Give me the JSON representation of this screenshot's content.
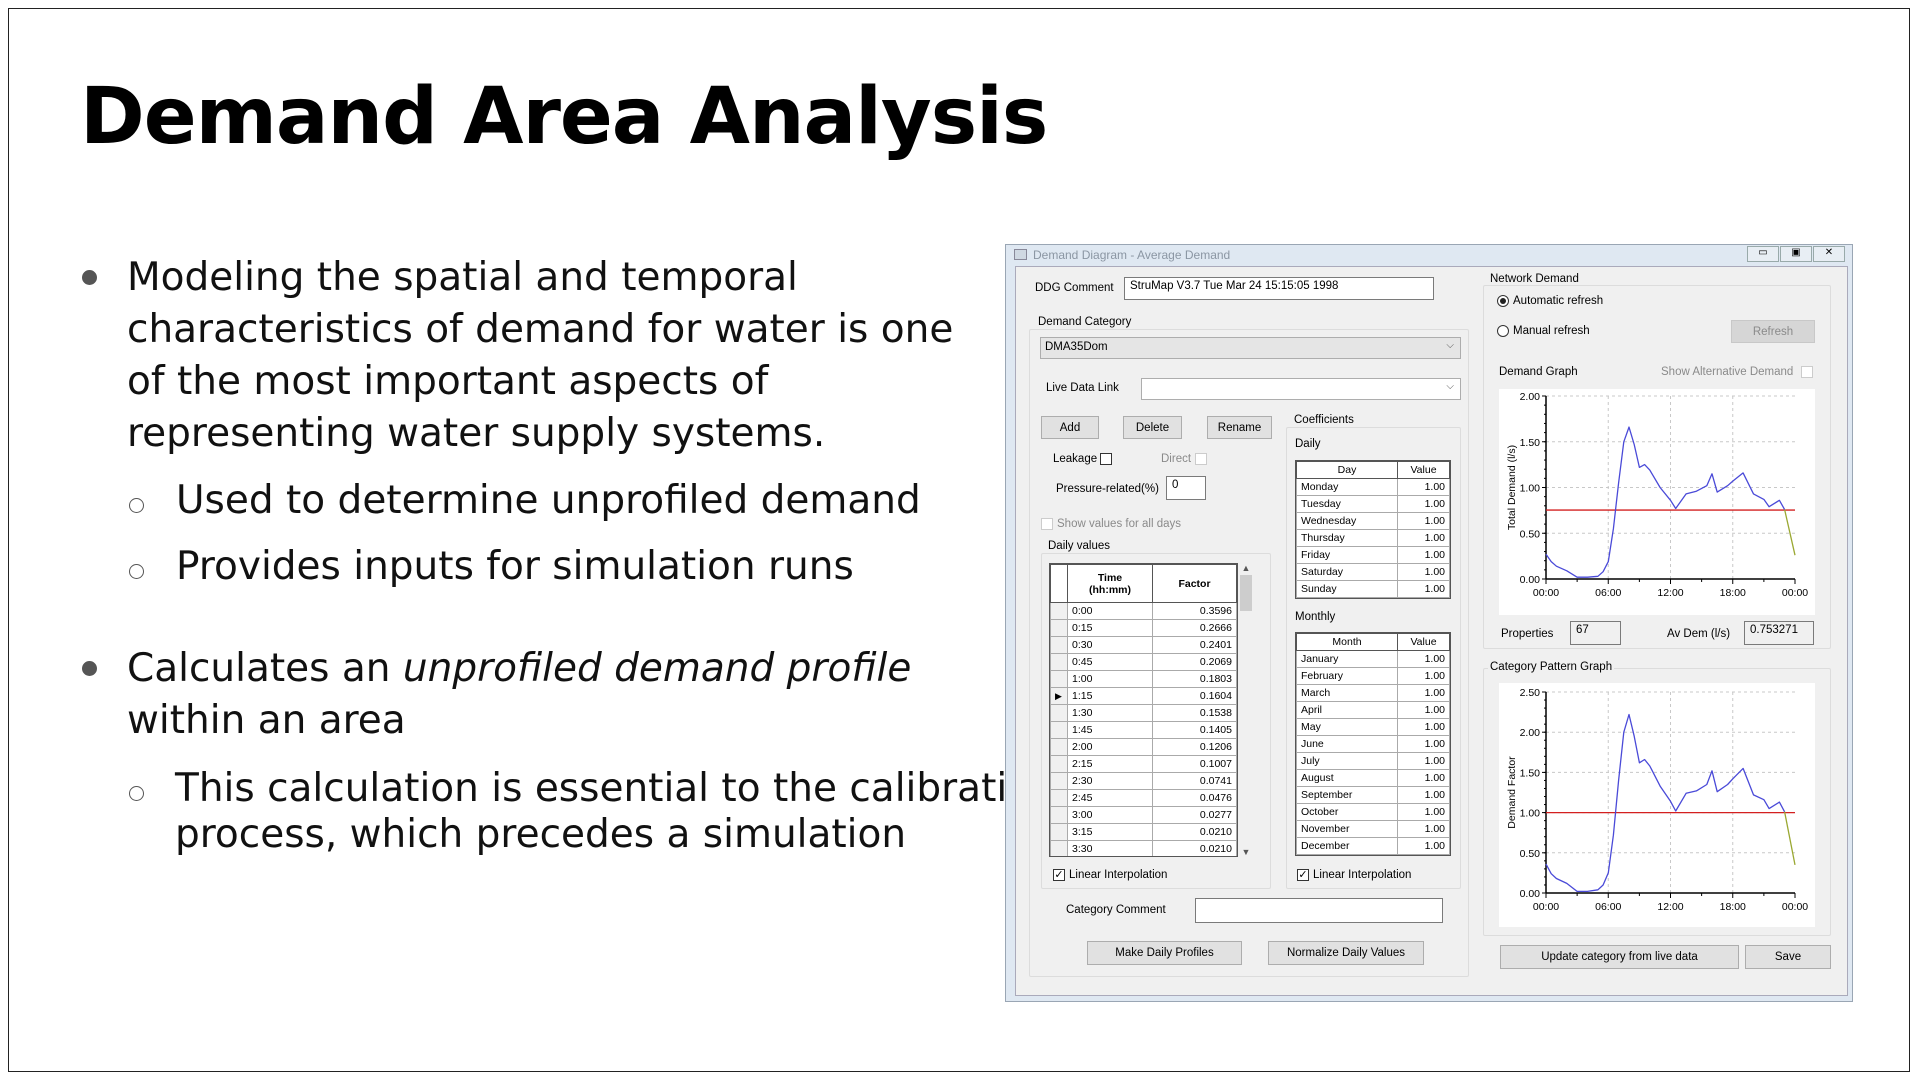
{
  "slide": {
    "title": "Demand Area Analysis",
    "bullets": [
      {
        "text": "Modeling the spatial and temporal characteristics of demand for water is one of the most important aspects of representing water supply systems.",
        "lines": [
          "Modeling the spatial and temporal",
          "characteristics of demand for water is one",
          "of the most important aspects of",
          "representing water supply systems."
        ],
        "sub": [
          "Used to determine unprofiled demand",
          "Provides inputs for simulation runs"
        ]
      },
      {
        "pre": "Calculates an ",
        "em": "unprofiled demand profile",
        "line2": "within an area",
        "sub_lines": [
          "This calculation is essential to the calibration",
          "process, which precedes a simulation"
        ]
      }
    ]
  },
  "dialog": {
    "title": "Demand Diagram - Average Demand",
    "ddg_comment_label": "DDG Comment",
    "ddg_comment_value": "StruMap V3.7 Tue Mar 24 15:15:05 1998",
    "demand_category_label": "Demand Category",
    "demand_category_value": "DMA35Dom",
    "live_data_link_label": "Live Data Link",
    "live_data_link_value": "",
    "add": "Add",
    "delete": "Delete",
    "rename": "Rename",
    "leakage_label": "Leakage",
    "leakage_checked": false,
    "direct_label": "Direct",
    "pressure_label": "Pressure-related(%)",
    "pressure_value": "0",
    "show_all_days_label": "Show values for all days",
    "daily_values_label": "Daily values",
    "daily_table": {
      "headers": [
        "Time\n(hh:mm)",
        "Factor"
      ],
      "header_time": "Time",
      "header_time2": "(hh:mm)",
      "header_factor": "Factor",
      "selected_row": 5,
      "rows": [
        [
          "0:00",
          "0.3596"
        ],
        [
          "0:15",
          "0.2666"
        ],
        [
          "0:30",
          "0.2401"
        ],
        [
          "0:45",
          "0.2069"
        ],
        [
          "1:00",
          "0.1803"
        ],
        [
          "1:15",
          "0.1604"
        ],
        [
          "1:30",
          "0.1538"
        ],
        [
          "1:45",
          "0.1405"
        ],
        [
          "2:00",
          "0.1206"
        ],
        [
          "2:15",
          "0.1007"
        ],
        [
          "2:30",
          "0.0741"
        ],
        [
          "2:45",
          "0.0476"
        ],
        [
          "3:00",
          "0.0277"
        ],
        [
          "3:15",
          "0.0210"
        ],
        [
          "3:30",
          "0.0210"
        ]
      ]
    },
    "linear_interp_label": "Linear Interpolation",
    "coefficients_label": "Coefficients",
    "daily_label": "Daily",
    "day_table": {
      "headers": [
        "Day",
        "Value"
      ],
      "rows": [
        [
          "Monday",
          "1.00"
        ],
        [
          "Tuesday",
          "1.00"
        ],
        [
          "Wednesday",
          "1.00"
        ],
        [
          "Thursday",
          "1.00"
        ],
        [
          "Friday",
          "1.00"
        ],
        [
          "Saturday",
          "1.00"
        ],
        [
          "Sunday",
          "1.00"
        ]
      ]
    },
    "monthly_label": "Monthly",
    "month_table": {
      "headers": [
        "Month",
        "Value"
      ],
      "rows": [
        [
          "January",
          "1.00"
        ],
        [
          "February",
          "1.00"
        ],
        [
          "March",
          "1.00"
        ],
        [
          "April",
          "1.00"
        ],
        [
          "May",
          "1.00"
        ],
        [
          "June",
          "1.00"
        ],
        [
          "July",
          "1.00"
        ],
        [
          "August",
          "1.00"
        ],
        [
          "September",
          "1.00"
        ],
        [
          "October",
          "1.00"
        ],
        [
          "November",
          "1.00"
        ],
        [
          "December",
          "1.00"
        ]
      ]
    },
    "category_comment_label": "Category Comment",
    "category_comment_value": "",
    "make_daily_profiles": "Make Daily Profiles",
    "normalize_daily_values": "Normalize Daily Values",
    "network_demand_label": "Network Demand",
    "automatic_refresh": "Automatic refresh",
    "manual_refresh": "Manual refresh",
    "refresh_mode": "automatic",
    "refresh": "Refresh",
    "demand_graph_label": "Demand Graph",
    "show_alt_demand_label": "Show Alternative Demand",
    "properties_label": "Properties",
    "properties_value": "67",
    "av_dem_label": "Av Dem (l/s)",
    "av_dem_value": "0.753271",
    "category_pattern_label": "Category Pattern Graph",
    "update_category": "Update category from live data",
    "save": "Save"
  },
  "colors": {
    "curve": "#4a4ad8",
    "average_line": "#d42020",
    "curve_end": "#9aa832"
  },
  "chart_data": [
    {
      "type": "line",
      "title": "",
      "ylabel": "Total Demand (l/s)",
      "ylim": [
        0,
        2.0
      ],
      "yticks": [
        "0.00",
        "0.50",
        "1.00",
        "1.50",
        "2.00"
      ],
      "xticks": [
        "00:00",
        "06:00",
        "12:00",
        "18:00",
        "00:00"
      ],
      "grid": true,
      "x": [
        "00:00",
        "00:30",
        "01:00",
        "02:00",
        "03:00",
        "04:00",
        "05:00",
        "05:30",
        "06:00",
        "06:30",
        "07:00",
        "07:30",
        "08:00",
        "08:30",
        "09:00",
        "09:30",
        "10:00",
        "11:00",
        "12:00",
        "12:30",
        "13:30",
        "14:30",
        "15:30",
        "16:00",
        "16:30",
        "17:30",
        "18:00",
        "19:00",
        "20:00",
        "21:00",
        "21:30",
        "22:30",
        "23:00",
        "24:00"
      ],
      "series": [
        {
          "values": [
            0.27,
            0.19,
            0.14,
            0.09,
            0.02,
            0.02,
            0.03,
            0.08,
            0.19,
            0.55,
            1.05,
            1.5,
            1.66,
            1.47,
            1.22,
            1.25,
            1.19,
            1.0,
            0.86,
            0.77,
            0.93,
            0.96,
            1.02,
            1.15,
            0.95,
            1.02,
            1.07,
            1.16,
            0.93,
            0.87,
            0.79,
            0.86,
            0.76,
            0.26
          ]
        }
      ],
      "reference_line": 0.753271
    },
    {
      "type": "line",
      "title": "",
      "ylabel": "Demand Factor",
      "ylim": [
        0,
        2.5
      ],
      "yticks": [
        "0.00",
        "0.50",
        "1.00",
        "1.50",
        "2.00",
        "2.50"
      ],
      "xticks": [
        "00:00",
        "06:00",
        "12:00",
        "18:00",
        "00:00"
      ],
      "grid": true,
      "x": [
        "00:00",
        "00:30",
        "01:00",
        "02:00",
        "03:00",
        "04:00",
        "05:00",
        "05:30",
        "06:00",
        "06:30",
        "07:00",
        "07:30",
        "08:00",
        "08:30",
        "09:00",
        "09:30",
        "10:00",
        "11:00",
        "12:00",
        "12:30",
        "13:30",
        "14:30",
        "15:30",
        "16:00",
        "16:30",
        "17:30",
        "18:00",
        "19:00",
        "20:00",
        "21:00",
        "21:30",
        "22:30",
        "23:00",
        "24:00"
      ],
      "series": [
        {
          "values": [
            0.36,
            0.24,
            0.18,
            0.12,
            0.02,
            0.02,
            0.04,
            0.1,
            0.25,
            0.72,
            1.4,
            2.0,
            2.22,
            1.95,
            1.62,
            1.66,
            1.58,
            1.33,
            1.14,
            1.02,
            1.24,
            1.27,
            1.35,
            1.52,
            1.26,
            1.35,
            1.42,
            1.55,
            1.22,
            1.16,
            1.05,
            1.13,
            1.01,
            0.35
          ]
        }
      ],
      "reference_line": 1.0
    }
  ]
}
